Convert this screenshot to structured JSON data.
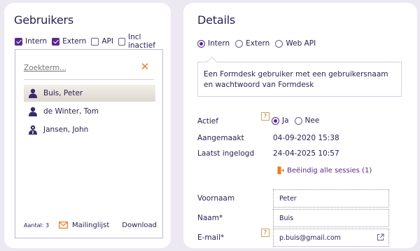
{
  "users_panel": {
    "title": "Gebruikers",
    "filters": [
      {
        "label": "Intern",
        "checked": true
      },
      {
        "label": "Extern",
        "checked": true
      },
      {
        "label": "API",
        "checked": false
      },
      {
        "label": "Incl inactief",
        "checked": false
      }
    ],
    "search": {
      "placeholder": "Zoekterm...",
      "value": ""
    },
    "users": [
      {
        "name": "Buis, Peter",
        "selected": true,
        "icon": "user-icon"
      },
      {
        "name": "de Winter, Tom",
        "selected": false,
        "icon": "user-icon"
      },
      {
        "name": "Jansen, John",
        "selected": false,
        "icon": "user-key-icon"
      }
    ],
    "footer": {
      "count_label": "Aantal: 3",
      "mailinglist_label": "Mailinglijst",
      "download_label": "Download"
    }
  },
  "details_panel": {
    "title": "Details",
    "user_types": [
      {
        "label": "Intern",
        "selected": true
      },
      {
        "label": "Extern",
        "selected": false
      },
      {
        "label": "Web API",
        "selected": false
      }
    ],
    "description": "Een Formdesk gebruiker met een gebruikersnaam en wachtwoord van Formdesk",
    "actief": {
      "label": "Actief",
      "options": [
        {
          "label": "Ja",
          "selected": true
        },
        {
          "label": "Nee",
          "selected": false
        }
      ]
    },
    "aangemaakt": {
      "label": "Aangemaakt",
      "value": "04-09-2020 15:38"
    },
    "laatst_ingelogd": {
      "label": "Laatst ingelogd",
      "value": "24-04-2025 10:57"
    },
    "end_sessions_label": "Beëindig alle sessies (1)",
    "voornaam": {
      "label": "Voornaam",
      "value": "Peter"
    },
    "naam": {
      "label": "Naam*",
      "value": "Buis"
    },
    "email": {
      "label": "E-mail*",
      "value": "p.buis@gmail.com"
    },
    "help_glyph": "?"
  },
  "colors": {
    "accent": "#5a2a8a",
    "orange": "#f07a1e",
    "background": "#ece9f3"
  }
}
